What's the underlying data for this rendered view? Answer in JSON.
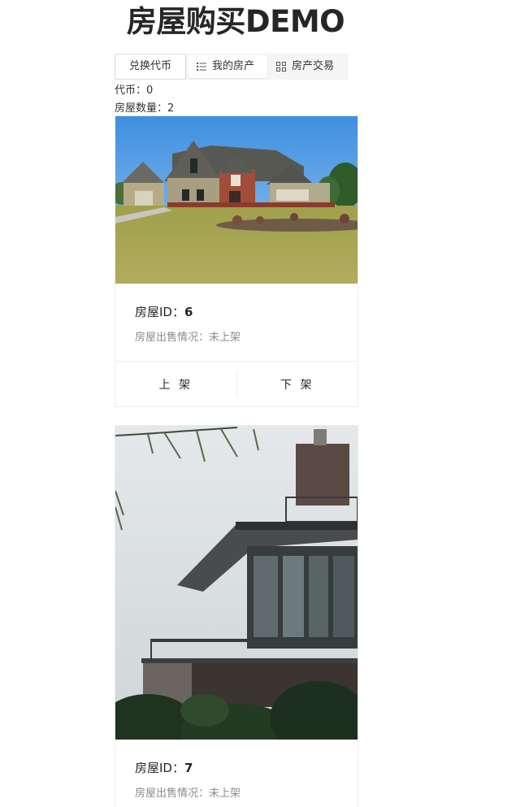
{
  "header": {
    "title": "房屋购买DEMO"
  },
  "toolbar": {
    "exchange_label": "兑换代币",
    "tabs": [
      {
        "label": "我的房产",
        "icon": "list-icon",
        "active": true
      },
      {
        "label": "房产交易",
        "icon": "grid-icon",
        "active": false
      }
    ]
  },
  "account": {
    "coins_label": "代币：0",
    "house_count_label": "房屋数量：2"
  },
  "houses": [
    {
      "title_prefix": "房屋ID：",
      "id": "6",
      "status": "房屋出售情况：未上架",
      "actions": [
        "上 架",
        "下 架"
      ]
    },
    {
      "title_prefix": "房屋ID：",
      "id": "7",
      "status": "房屋出售情况：未上架"
    }
  ],
  "colors": {
    "sky": "#5a9fdf",
    "grass": "#a7a555",
    "modern_sky": "#d9dee2",
    "border": "#ececec"
  }
}
